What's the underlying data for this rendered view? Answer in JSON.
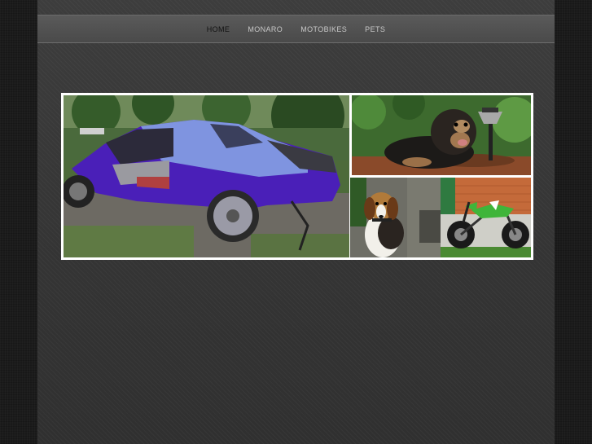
{
  "nav": {
    "items": [
      {
        "label": "HOME",
        "active": true
      },
      {
        "label": "MONARO",
        "active": false
      },
      {
        "label": "MOTOBIKES",
        "active": false
      },
      {
        "label": "PETS",
        "active": false
      }
    ]
  },
  "gallery": {
    "photos": [
      {
        "name": "car-photo",
        "subject": "purple-car-under-restoration"
      },
      {
        "name": "dog-photo",
        "subject": "black-tan-dog-in-garden"
      },
      {
        "name": "beagle-photo",
        "subject": "beagle-puppy"
      },
      {
        "name": "motorbike-photo",
        "subject": "green-dirt-bike"
      }
    ]
  },
  "colors": {
    "page_bg": "#3a3a3a",
    "outer_bg": "#1b1b1b",
    "nav_bg": "#4f4f4f",
    "nav_text": "#c8c8c8",
    "nav_active_text": "#111111",
    "car_purple": "#4a1fb8",
    "car_hood": "#7f94e0"
  }
}
